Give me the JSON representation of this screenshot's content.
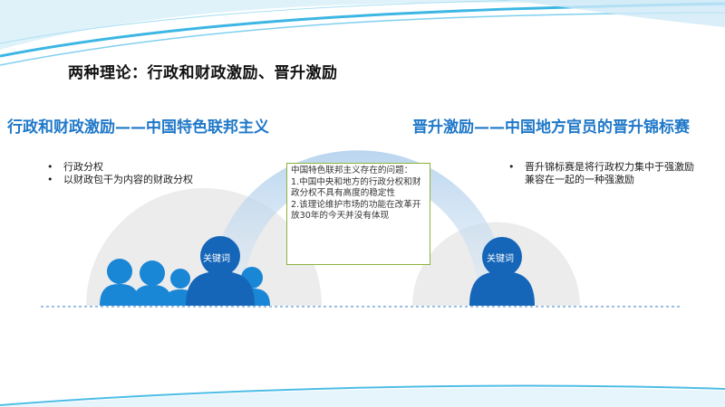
{
  "title": "两种理论：行政和财政激励、晋升激励",
  "left": {
    "heading": "行政和财政激励——中国特色联邦主义",
    "bullets": [
      "行政分权",
      "以财政包干为内容的财政分权"
    ],
    "keyword_label": "关键词"
  },
  "right": {
    "heading": "晋升激励——中国地方官员的晋升锦标赛",
    "bullets": [
      "晋升锦标赛是将行政权力集中于强激励兼容在一起的一种强激励"
    ],
    "keyword_label": "关键词"
  },
  "center_box": {
    "lines": [
      "中国特色联邦主义存在的问题：",
      "1.中国中央和地方的行政分权和财政分权不具有高度的稳定性",
      "2.该理论维护市场的功能在改革开放30年的今天并没有体现"
    ]
  },
  "colors": {
    "accent_blue": "#1f78c8",
    "people_blue": "#1a86d6",
    "box_border": "#8cb33a",
    "circle_gray": "#ececec"
  }
}
